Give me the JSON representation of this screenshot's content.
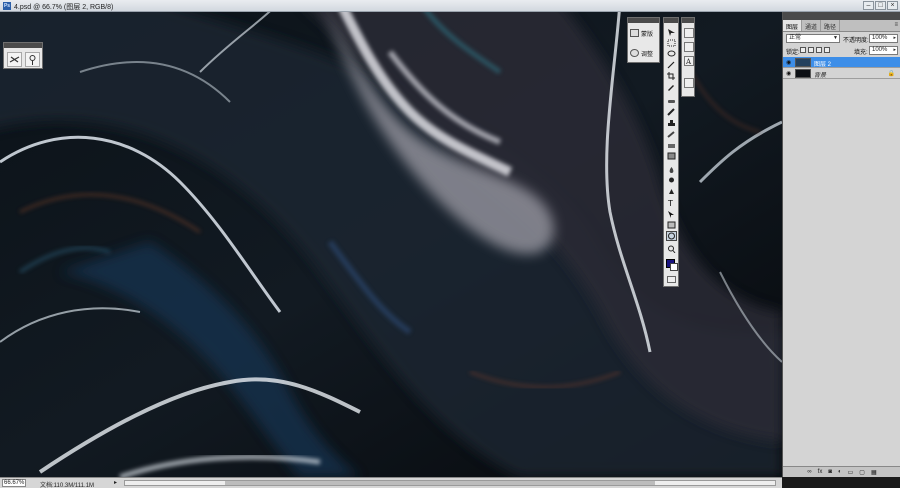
{
  "window": {
    "title": "4.psd @ 66.7% (图层 2, RGB/8)",
    "app_icon": "Ps",
    "buttons": [
      "–",
      "□",
      "×"
    ]
  },
  "options_panel": {
    "buttons": [
      "brush-settings-icon",
      "clone-source-icon"
    ]
  },
  "adjust_panel": {
    "items": [
      {
        "label": "蒙版",
        "icon": "mask-icon"
      },
      {
        "label": "调整",
        "icon": "adjust-icon"
      }
    ]
  },
  "toolbox": {
    "tools": [
      "move-icon",
      "marquee-icon",
      "lasso-icon",
      "magic-wand-icon",
      "crop-icon",
      "eyedropper-icon",
      "healing-icon",
      "brush-icon",
      "stamp-icon",
      "history-brush-icon",
      "eraser-icon",
      "gradient-icon",
      "blur-icon",
      "dodge-icon",
      "pen-icon",
      "type-icon",
      "path-select-icon",
      "shape-icon",
      "3d-rotate-icon",
      "zoom-icon"
    ],
    "foreground_color": "#1a1480",
    "background_color": "#ffffff"
  },
  "icon_strip": {
    "items": [
      "histogram-icon",
      "navigator-icon",
      "character-icon",
      "paragraph-icon"
    ]
  },
  "layers_panel": {
    "tabs": [
      "图层",
      "通道",
      "路径"
    ],
    "active_tab": 0,
    "blend_mode": "正常",
    "opacity_label": "不透明度:",
    "opacity_value": "100%",
    "lock_label": "锁定:",
    "fill_label": "填充:",
    "fill_value": "100%",
    "layers": [
      {
        "name": "图层 2",
        "selected": true,
        "visible": true
      },
      {
        "name": "背景",
        "selected": false,
        "visible": true,
        "locked": true
      }
    ],
    "bottom_buttons": [
      "link-icon",
      "fx",
      "mask-icon",
      "adjust-icon",
      "folder-icon",
      "new-layer-icon",
      "trash-icon"
    ]
  },
  "statusbar": {
    "zoom": "66.67%",
    "doc_info": "文档:110.3M/111.1M"
  }
}
